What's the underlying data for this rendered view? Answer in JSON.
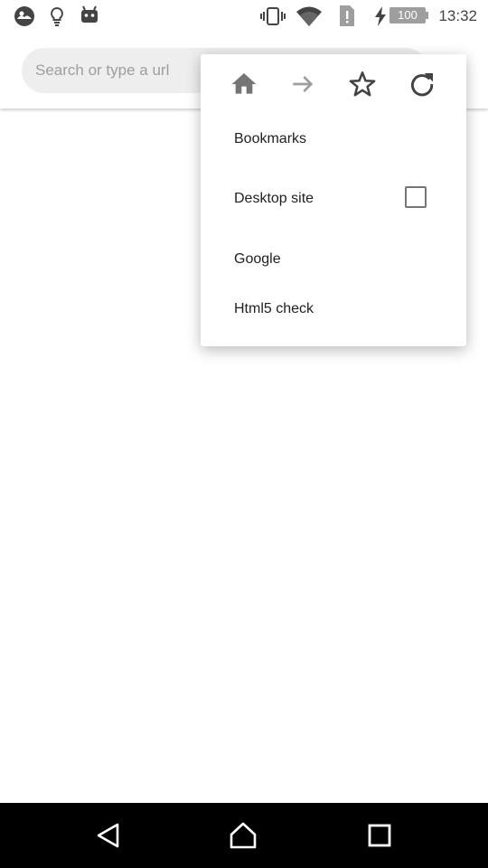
{
  "status_bar": {
    "time": "13:32",
    "battery_level": "100",
    "icons": [
      "weather-icon",
      "lightbulb-icon",
      "android-icon",
      "vibrate-icon",
      "wifi-icon",
      "sim-alert-icon",
      "charging-icon",
      "battery-icon"
    ]
  },
  "url_bar": {
    "placeholder": "Search or type a url"
  },
  "menu": {
    "icons": [
      "home-icon",
      "forward-icon",
      "star-icon",
      "refresh-icon"
    ],
    "items": {
      "bookmarks": "Bookmarks",
      "desktop_site": "Desktop site",
      "google": "Google",
      "html5_check": "Html5 check"
    },
    "desktop_site_checked": false
  },
  "nav_bar": {
    "icons": [
      "back-icon",
      "home-nav-icon",
      "recents-icon"
    ]
  },
  "colors": {
    "menu_icon_gray": "#757575",
    "url_bar_bg": "#eeeeee",
    "nav_bar_bg": "#000000"
  }
}
